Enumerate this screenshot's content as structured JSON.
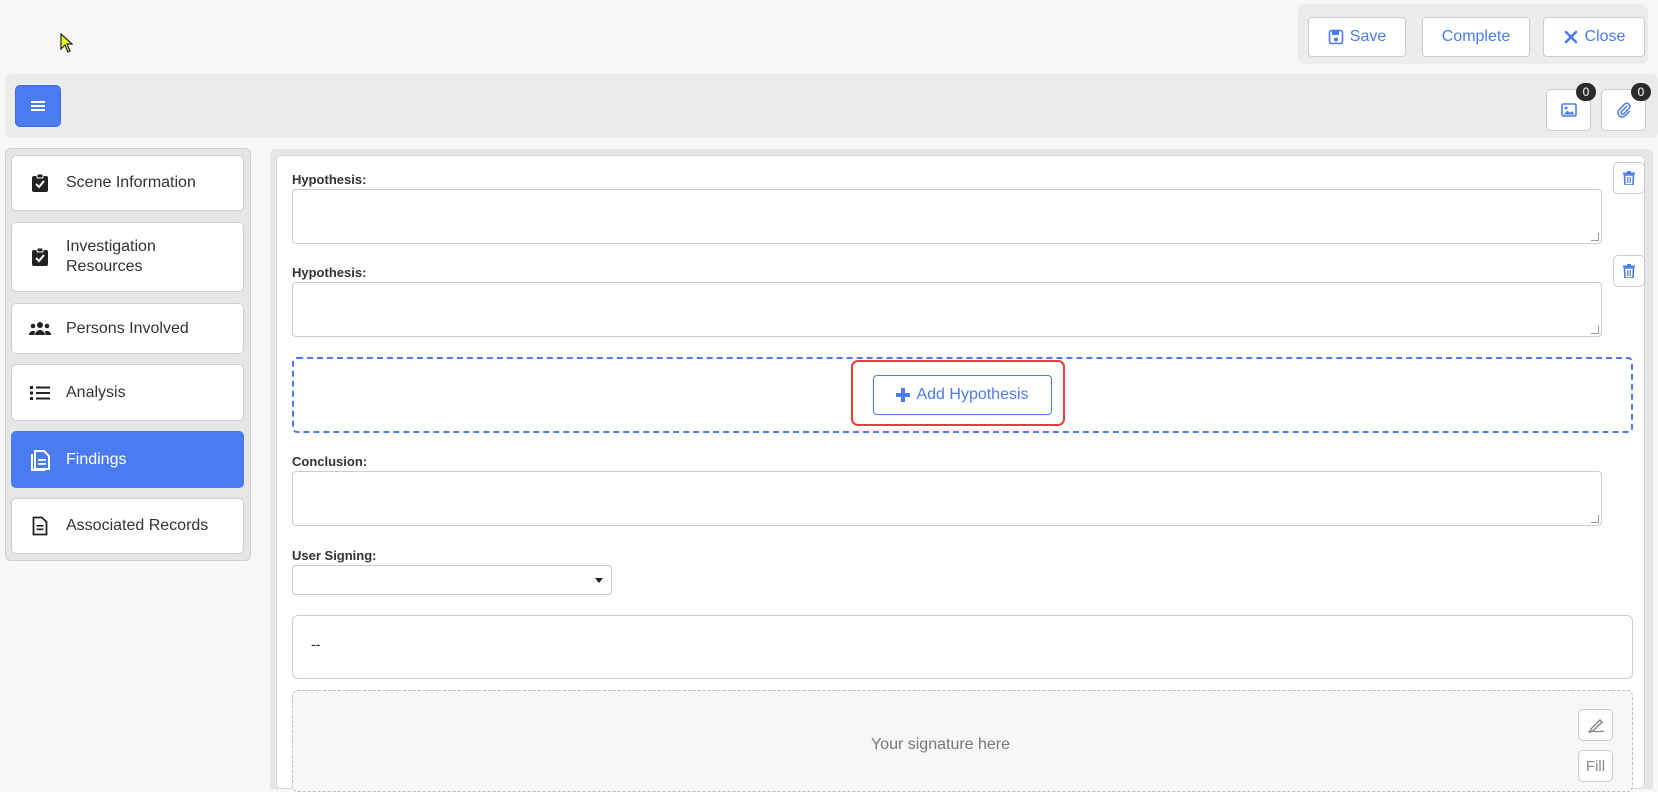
{
  "top_actions": {
    "save_label": "Save",
    "complete_label": "Complete",
    "close_label": "Close"
  },
  "header": {
    "images_count": "0",
    "attachments_count": "0"
  },
  "sidebar": {
    "items": [
      {
        "label": "Scene Information",
        "icon": "clipboard-check-icon"
      },
      {
        "label": "Investigation Resources",
        "icon": "clipboard-check-icon"
      },
      {
        "label": "Persons Involved",
        "icon": "users-icon"
      },
      {
        "label": "Analysis",
        "icon": "list-icon"
      },
      {
        "label": "Findings",
        "icon": "file-lines-icon",
        "active": true
      },
      {
        "label": "Associated Records",
        "icon": "file-text-icon"
      }
    ]
  },
  "main": {
    "hypotheses": [
      {
        "label": "Hypothesis:",
        "value": ""
      },
      {
        "label": "Hypothesis:",
        "value": ""
      }
    ],
    "add_hypothesis_label": "Add Hypothesis",
    "conclusion_label": "Conclusion:",
    "conclusion_value": "",
    "user_signing_label": "User Signing:",
    "user_signing_value": "",
    "signer_display": "--",
    "signature_placeholder": "Your signature here",
    "fill_label": "Fill"
  },
  "colors": {
    "accent": "#4a7bf0",
    "highlight": "#e0413a"
  }
}
